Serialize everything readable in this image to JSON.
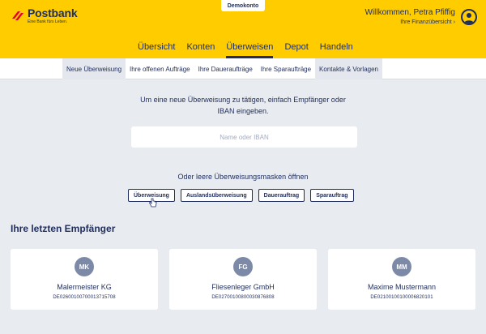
{
  "header": {
    "brand": "Postbank",
    "tagline": "Eine Bank fürs Leben.",
    "demo_badge": "Demokonto",
    "welcome": "Willkommen, Petra Pfiffig",
    "finance_link": "Ihre Finanzübersicht",
    "finance_link_arrow": "›",
    "brand_color": "#ffcc00",
    "logo_color": "#e4002b"
  },
  "main_nav": {
    "items": [
      {
        "label": "Übersicht"
      },
      {
        "label": "Konten"
      },
      {
        "label": "Überweisen"
      },
      {
        "label": "Depot"
      },
      {
        "label": "Handeln"
      }
    ],
    "active": "Überweisen"
  },
  "sub_nav": {
    "items": [
      {
        "label": "Neue Überweisung"
      },
      {
        "label": "Ihre offenen Aufträge"
      },
      {
        "label": "Ihre Daueraufträge"
      },
      {
        "label": "Ihre Sparaufträge"
      },
      {
        "label": "Kontakte & Vorlagen"
      }
    ]
  },
  "content": {
    "intro_line1": "Um eine neue Überweisung zu tätigen, einfach Empfänger oder",
    "intro_line2": "IBAN eingeben.",
    "search_placeholder": "Name oder IBAN",
    "masks_label": "Oder leere Überweisungsmasken öffnen",
    "mask_buttons": [
      {
        "label": "Überweisung"
      },
      {
        "label": "Auslandsüberweisung"
      },
      {
        "label": "Dauerauftrag"
      },
      {
        "label": "Sparauftrag"
      }
    ]
  },
  "recipients": {
    "title": "Ihre letzten Empfänger",
    "items": [
      {
        "initials": "MK",
        "name": "Malermeister KG",
        "iban": "DE02600100700013715708"
      },
      {
        "initials": "FG",
        "name": "Fliesenleger GmbH",
        "iban": "DE02700100800030876808"
      },
      {
        "initials": "MM",
        "name": "Maxime Mustermann",
        "iban": "DE02100100100006820101"
      }
    ]
  }
}
